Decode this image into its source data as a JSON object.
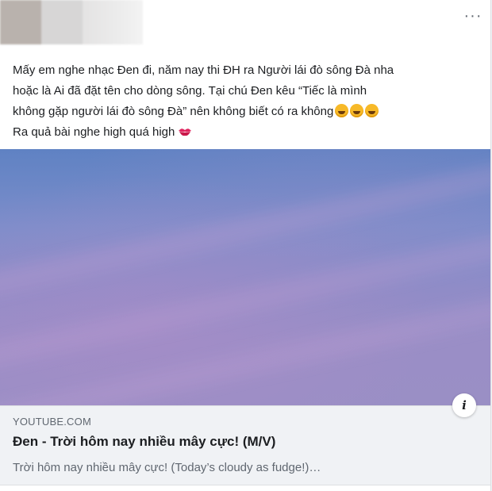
{
  "post": {
    "text_line1": "Mấy em nghe nhạc Đen đi, năm nay thi ĐH ra Người lái đò sông Đà nha",
    "text_line2": "hoặc là Ai đã đặt tên cho dòng sông. Tại chú Đen kêu “Tiếc là mình",
    "text_line3": "không gặp người lái đò sông Đà” nên không biết có ra không",
    "text_line4": "Ra quả bài nghe high quá high",
    "emoji_laugh": "rolling-on-floor-laughing-emoji",
    "emoji_kiss": "kiss-mark-emoji",
    "more_icon": "···"
  },
  "link_preview": {
    "domain": "YOUTUBE.COM",
    "title": "Đen - Trời hôm nay nhiều mây cực! (M/V)",
    "description": "Trời hôm nay nhiều mây cực! (Today’s cloudy as fudge!)…",
    "info_icon": "i"
  },
  "colors": {
    "sky_top": "#5f82c3",
    "sky_bottom": "#9a8fc5",
    "text_primary": "#1c1e21",
    "text_secondary": "#606770",
    "link_bg": "#f0f2f5"
  }
}
